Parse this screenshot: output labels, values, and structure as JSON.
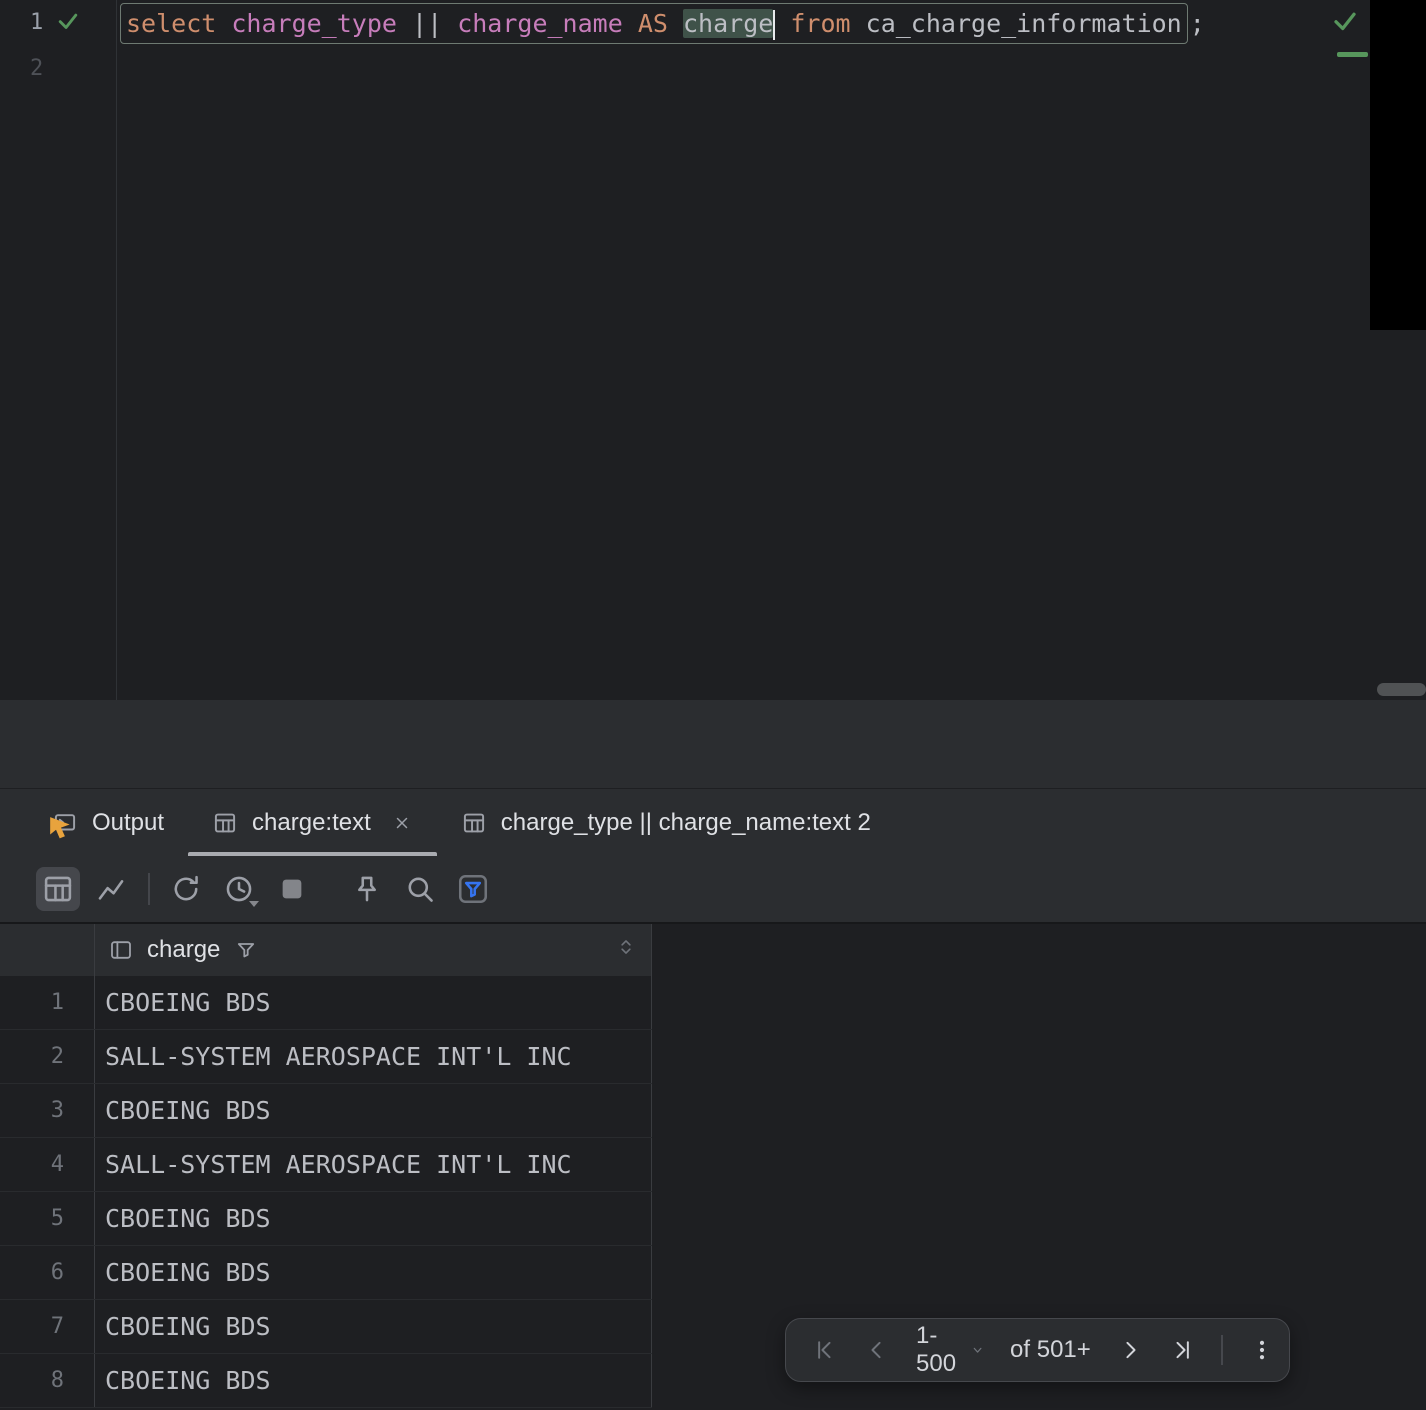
{
  "editor": {
    "line_numbers": [
      "1",
      "2"
    ],
    "statement": {
      "tokens": [
        {
          "t": "select",
          "c": "keyword"
        },
        {
          "t": " ",
          "c": "plain"
        },
        {
          "t": "charge_type",
          "c": "column"
        },
        {
          "t": " ",
          "c": "plain"
        },
        {
          "t": "||",
          "c": "plain"
        },
        {
          "t": " ",
          "c": "plain"
        },
        {
          "t": "charge_name",
          "c": "column"
        },
        {
          "t": " ",
          "c": "plain"
        },
        {
          "t": "AS",
          "c": "keyword"
        },
        {
          "t": " ",
          "c": "plain"
        },
        {
          "t": "charge",
          "c": "plain",
          "selected": true,
          "caret_after": true
        },
        {
          "t": " ",
          "c": "plain"
        },
        {
          "t": "from",
          "c": "keyword"
        },
        {
          "t": " ",
          "c": "plain"
        },
        {
          "t": "ca_charge_information",
          "c": "plain"
        }
      ],
      "trailing": ";"
    }
  },
  "tabs": {
    "output": {
      "label": "Output"
    },
    "active": {
      "label": "charge:text"
    },
    "third": {
      "label": "charge_type || charge_name:text 2"
    }
  },
  "toolbar": {
    "icons": [
      "table-view",
      "chart-view",
      "refresh",
      "history",
      "stop",
      "pin",
      "find",
      "filter-rows"
    ]
  },
  "grid": {
    "header": {
      "column": "charge"
    },
    "rows": [
      {
        "n": "1",
        "value": "CBOEING BDS"
      },
      {
        "n": "2",
        "value": "SALL-SYSTEM AEROSPACE INT'L INC"
      },
      {
        "n": "3",
        "value": "CBOEING BDS"
      },
      {
        "n": "4",
        "value": "SALL-SYSTEM AEROSPACE INT'L INC"
      },
      {
        "n": "5",
        "value": "CBOEING BDS"
      },
      {
        "n": "6",
        "value": "CBOEING BDS"
      },
      {
        "n": "7",
        "value": "CBOEING BDS"
      },
      {
        "n": "8",
        "value": "CBOEING BDS"
      }
    ]
  },
  "pagination": {
    "range": "1-500",
    "total": "of 501+"
  },
  "colors": {
    "keyword": "#cf8e6d",
    "identifier": "#c77dbb",
    "plain_text": "#bcbec4",
    "selection_bg": "#3f5249",
    "check_green": "#57965c",
    "filter_accent": "#3574f0",
    "editor_bg": "#1e1f22",
    "panel_bg": "#2b2d30"
  }
}
